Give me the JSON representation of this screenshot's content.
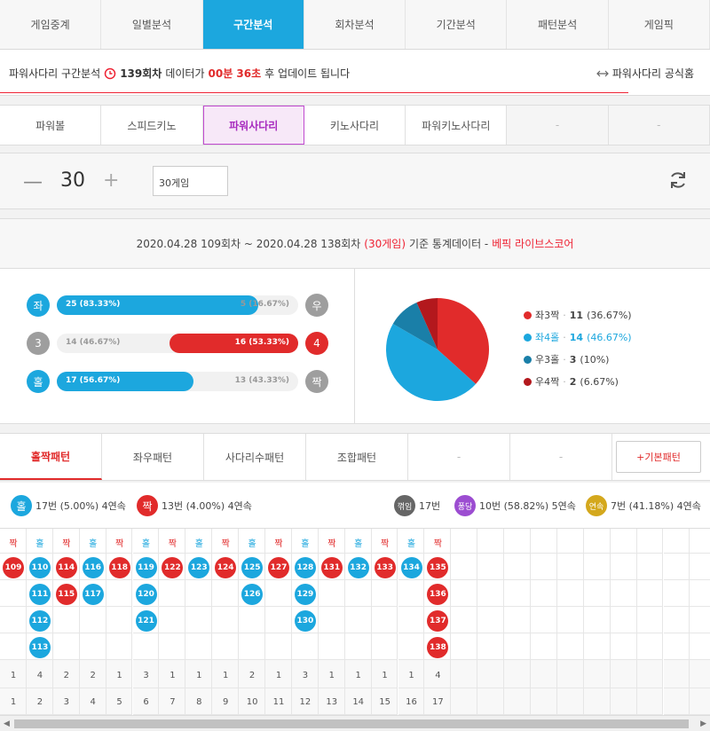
{
  "nav": [
    "게임중계",
    "일별분석",
    "구간분석",
    "회차분석",
    "기간분석",
    "패턴분석",
    "게임픽"
  ],
  "nav_active": 2,
  "info": {
    "prefix": "파워사다리 구간분석",
    "round": "139회차",
    "mid": "데이터가",
    "time": "00분 36초",
    "suffix": "후 업데이트 됩니다",
    "official": "파워사다리 공식홈"
  },
  "subnav": [
    "파워볼",
    "스피드키노",
    "파워사다리",
    "키노사다리",
    "파워키노사다리",
    "-",
    "-"
  ],
  "subnav_active": 2,
  "control": {
    "minus": "—",
    "value": "30",
    "plus": "+",
    "select": "30게임"
  },
  "stats": {
    "period": "2020.04.28 109회차 ~ 2020.04.28 138회차",
    "games": "(30게임)",
    "mid": "기준 통계데이터 -",
    "brand": "베픽 라이브스코어",
    "rows": [
      {
        "left": "좌",
        "right": "우",
        "left_label": "25 (83.33%)",
        "right_label": "5 (16.67%)",
        "left_pct": 83.33,
        "winner": "left",
        "lc": "#1ca7de",
        "rc": "#9e9e9e"
      },
      {
        "left": "3",
        "right": "4",
        "left_label": "14 (46.67%)",
        "right_label": "16 (53.33%)",
        "left_pct": 46.67,
        "winner": "right",
        "lc": "#9e9e9e",
        "rc": "#e12b2b"
      },
      {
        "left": "홀",
        "right": "짝",
        "left_label": "17 (56.67%)",
        "right_label": "13 (43.33%)",
        "left_pct": 56.67,
        "winner": "left",
        "lc": "#1ca7de",
        "rc": "#9e9e9e"
      }
    ],
    "pie": [
      {
        "name": "좌3짝",
        "count": "11",
        "pct": "(36.67%)",
        "value": 36.67,
        "color": "#e12b2b"
      },
      {
        "name": "좌4홀",
        "count": "14",
        "pct": "(46.67%)",
        "value": 46.67,
        "color": "#1ca7de"
      },
      {
        "name": "우3홀",
        "count": "3",
        "pct": "(10%)",
        "value": 10,
        "color": "#1a7fa8"
      },
      {
        "name": "우4짝",
        "count": "2",
        "pct": "(6.67%)",
        "value": 6.67,
        "color": "#b3181d"
      }
    ]
  },
  "ptabs": [
    "홀짝패턴",
    "좌우패턴",
    "사다리수패턴",
    "조합패턴",
    "-",
    "-"
  ],
  "ptabs_active": 0,
  "basic_pattern": "+기본패턴",
  "summary": {
    "odd": {
      "icon": "홀",
      "text": "17번 (5.00%) 4연속"
    },
    "even": {
      "icon": "짝",
      "text": "13번 (4.00%) 4연속"
    },
    "break": {
      "icon": "꺾임",
      "text": "17번"
    },
    "pong": {
      "icon": "퐁당",
      "text": "10번 (58.82%) 5연속"
    },
    "streak": {
      "icon": "연속",
      "text": "7번 (41.18%) 4연속"
    }
  },
  "pattern": {
    "columns": [
      {
        "h": "짝",
        "balls": [
          "109"
        ]
      },
      {
        "h": "홀",
        "balls": [
          "110",
          "111",
          "112",
          "113"
        ]
      },
      {
        "h": "짝",
        "balls": [
          "114",
          "115"
        ]
      },
      {
        "h": "홀",
        "balls": [
          "116",
          "117"
        ]
      },
      {
        "h": "짝",
        "balls": [
          "118"
        ]
      },
      {
        "h": "홀",
        "balls": [
          "119",
          "120",
          "121"
        ]
      },
      {
        "h": "짝",
        "balls": [
          "122"
        ]
      },
      {
        "h": "홀",
        "balls": [
          "123"
        ]
      },
      {
        "h": "짝",
        "balls": [
          "124"
        ]
      },
      {
        "h": "홀",
        "balls": [
          "125",
          "126"
        ]
      },
      {
        "h": "짝",
        "balls": [
          "127"
        ]
      },
      {
        "h": "홀",
        "balls": [
          "128",
          "129",
          "130"
        ]
      },
      {
        "h": "짝",
        "balls": [
          "131"
        ]
      },
      {
        "h": "홀",
        "balls": [
          "132"
        ]
      },
      {
        "h": "짝",
        "balls": [
          "133"
        ]
      },
      {
        "h": "홀",
        "balls": [
          "134"
        ]
      },
      {
        "h": "짝",
        "balls": [
          "135",
          "136",
          "137",
          "138"
        ]
      }
    ],
    "counts": [
      "1",
      "4",
      "2",
      "2",
      "1",
      "3",
      "1",
      "1",
      "1",
      "2",
      "1",
      "3",
      "1",
      "1",
      "1",
      "1",
      "4"
    ],
    "indexes": [
      "1",
      "2",
      "3",
      "4",
      "5",
      "6",
      "7",
      "8",
      "9",
      "10",
      "11",
      "12",
      "13",
      "14",
      "15",
      "16",
      "17"
    ]
  }
}
